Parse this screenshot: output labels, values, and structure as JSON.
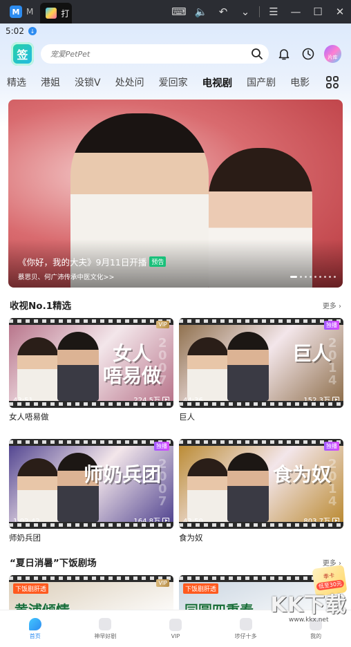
{
  "emulator": {
    "inactive_tab": "M",
    "active_tab": "打",
    "tools": [
      "⌨",
      "🔈",
      "↶",
      "⌄",
      "☰",
      "—",
      "☐",
      "✕"
    ]
  },
  "status": {
    "time": "5:02"
  },
  "header": {
    "logo_text": "签",
    "search_placeholder": "宠爱PetPet",
    "library_label": "片库"
  },
  "tabs": [
    "精选",
    "港姐",
    "没锁V",
    "处处问",
    "爱回家",
    "电视剧",
    "国产剧",
    "电影"
  ],
  "active_tab": "电视剧",
  "banner": {
    "title": "《你好，我的大夫》9月11日开播",
    "badge": "预告",
    "subtitle": "蔡思贝、何广沛传承中医文化>>"
  },
  "section1": {
    "title": "收视No.1精选",
    "more": "更多",
    "cards": [
      {
        "title": "女人唔易做",
        "art": "女人\n唔易做",
        "year": "2007",
        "tag": "VIP",
        "tag_type": "vip",
        "duration": "43:51",
        "views": "224.5万",
        "bg": "#b56f86"
      },
      {
        "title": "巨人",
        "art": "巨人",
        "year": "2014",
        "tag": "独播",
        "tag_type": "ex",
        "duration": "44:36",
        "views": "152.3万",
        "bg": "#8a6a45"
      },
      {
        "title": "师奶兵团",
        "art": "师奶兵团",
        "year": "2007",
        "tag": "独播",
        "tag_type": "ex",
        "duration": "1:02:42",
        "views": "164.8万",
        "bg": "#4a3d8c"
      },
      {
        "title": "食为奴",
        "art": "食为奴",
        "year": "2014",
        "tag": "独播",
        "tag_type": "ex",
        "duration": "43:50",
        "views": "803.7万",
        "bg": "#b8862a"
      }
    ]
  },
  "section2": {
    "title": "“夏日消暑”下饭剧场",
    "more": "更多",
    "cards": [
      {
        "art": "黄浦倾情",
        "label": "下饭剧肝透",
        "tag": "VIP",
        "bg": "#d9cbb5"
      },
      {
        "art": "同圆四重奏",
        "label": "下饭剧肝透",
        "tag": "",
        "bg": "#c7d3df"
      }
    ]
  },
  "float_badge": {
    "line1": "季卡",
    "line2": "低至30元"
  },
  "bottom_nav": [
    {
      "label": "首页",
      "active": true
    },
    {
      "label": "神早好剧",
      "active": false
    },
    {
      "label": "VIP",
      "active": false
    },
    {
      "label": "埗仔十多",
      "active": false
    },
    {
      "label": "我的",
      "active": false
    }
  ],
  "watermark": {
    "big": "KK下载",
    "small": "www.kkx.net"
  },
  "colors": {
    "accent": "#2d8cf0",
    "preview_badge": "#19c07a",
    "vip": "#c9a35c",
    "exclusive": "#b65cff"
  }
}
